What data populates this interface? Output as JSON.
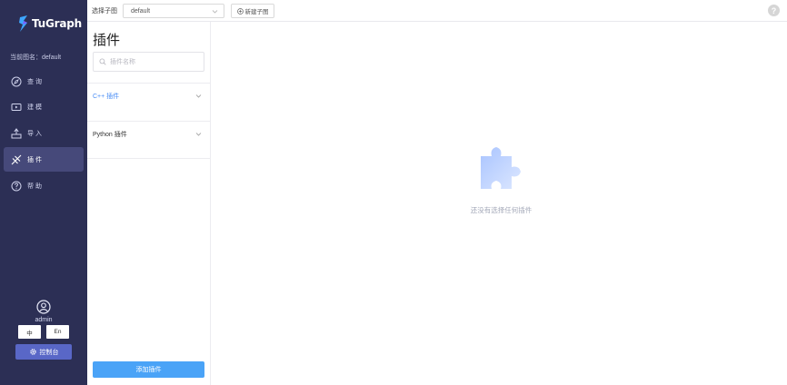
{
  "app": {
    "logo_text": "TuGraph"
  },
  "sidebar": {
    "current_graph": "当前图名：default",
    "items": [
      {
        "label": "查 询",
        "icon": "compass-icon"
      },
      {
        "label": "建 模",
        "icon": "model-icon"
      },
      {
        "label": "导 入",
        "icon": "import-icon"
      },
      {
        "label": "插 件",
        "icon": "plugin-icon",
        "active": true
      },
      {
        "label": "帮 助",
        "icon": "help-icon"
      }
    ],
    "username": "admin",
    "lang_zh": "中",
    "lang_en": "En",
    "console_label": "控制台"
  },
  "topbar": {
    "subgraph_label": "选择子图",
    "subgraph_value": "default",
    "new_subgraph_label": "新建子图",
    "help_glyph": "?"
  },
  "panel": {
    "title": "插件",
    "search_placeholder": "插件名称",
    "sections": [
      {
        "label": "C++ 插件",
        "open": true
      },
      {
        "label": "Python 插件",
        "open": false
      }
    ],
    "add_button": "添加插件"
  },
  "main": {
    "empty_text": "还没有选择任何插件"
  },
  "colors": {
    "sidebar_bg": "#2c2f55",
    "sidebar_active": "#46497a",
    "accent": "#4aa3f7",
    "console_button": "#5967c7",
    "link_active": "#4a8ef5"
  }
}
